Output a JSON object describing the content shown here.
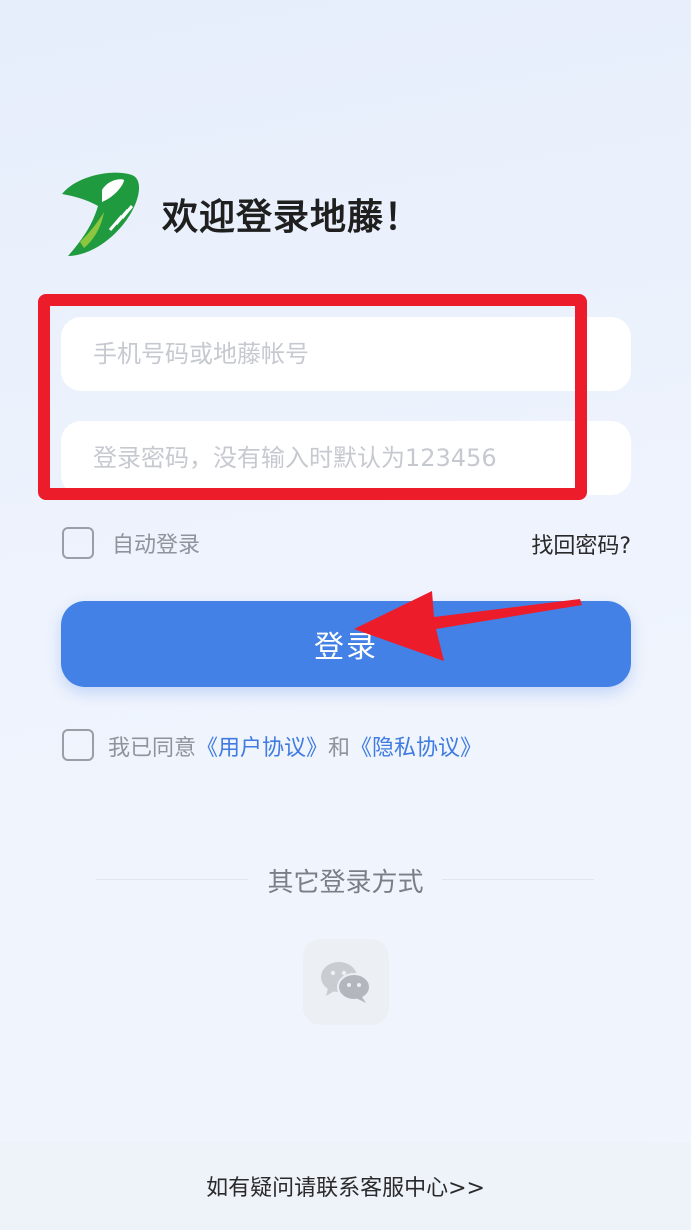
{
  "header": {
    "logo_icon": "ditter-leaf-logo-icon",
    "welcome_text": "欢迎登录地藤！"
  },
  "form": {
    "phone_placeholder": "手机号码或地藤帐号",
    "phone_value": "",
    "password_placeholder": "登录密码，没有输入时默认为123456",
    "password_value": "",
    "auto_login_label": "自动登录",
    "forgot_password_label": "找回密码?",
    "login_button_label": "登录"
  },
  "agreement": {
    "prefix": "我已同意",
    "user_agreement": "《用户协议》",
    "conjunction": "和",
    "privacy_agreement": "《隐私协议》"
  },
  "other_login": {
    "title": "其它登录方式",
    "wechat_icon": "wechat-icon"
  },
  "footer": {
    "contact_text": "如有疑问请联系客服中心>>"
  },
  "colors": {
    "primary": "#4381e6",
    "link": "#3f7be0",
    "annotation_red": "#ec1c2b",
    "logo_green": "#1f9a3e"
  }
}
